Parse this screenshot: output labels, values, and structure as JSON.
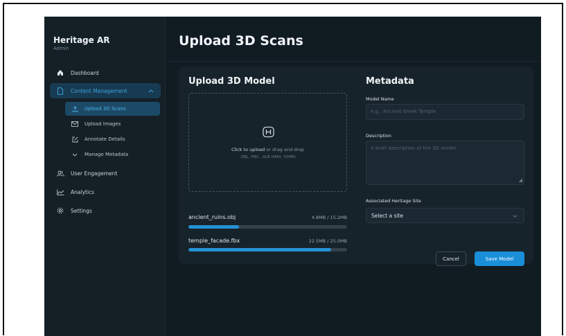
{
  "sidebar": {
    "app_title": "Heritage AR",
    "role": "Admin",
    "items": [
      {
        "label": "Dashboard",
        "icon": "home-icon"
      },
      {
        "label": "Content Management",
        "icon": "document-icon"
      },
      {
        "label": "User Engagement",
        "icon": "users-icon"
      },
      {
        "label": "Analytics",
        "icon": "chart-icon"
      },
      {
        "label": "Settings",
        "icon": "gear-icon"
      }
    ],
    "subitems": [
      {
        "label": "Upload 3D Scans",
        "icon": "upload-icon"
      },
      {
        "label": "Upload Images",
        "icon": "image-icon"
      },
      {
        "label": "Annotate Details",
        "icon": "edit-icon"
      },
      {
        "label": "Manage Metadata",
        "icon": "chevron-down-icon"
      }
    ]
  },
  "main": {
    "page_title": "Upload 3D Scans",
    "upload": {
      "title": "Upload 3D Model",
      "dropzone_action": "Click to upload",
      "dropzone_rest": " or drag and drop",
      "dropzone_formats": ".OBJ, .FBX, .GLB (MAX. 50MB)",
      "files": [
        {
          "name": "ancient_ruins.obj",
          "size": "4.8MB / 15.2MB",
          "progress": 0.32
        },
        {
          "name": "temple_facade.fbx",
          "size": "22.5MB / 25.0MB",
          "progress": 0.9
        }
      ]
    },
    "metadata": {
      "title": "Metadata",
      "model_name_label": "Model Name",
      "model_name_placeholder": "e.g., Ancient Greek Temple",
      "description_label": "Description",
      "description_placeholder": "A brief description of the 3D model.",
      "site_label": "Associated Heritage Site",
      "site_value": "Select a site",
      "cancel_label": "Cancel",
      "save_label": "Save Model"
    }
  },
  "colors": {
    "background": "#111b22",
    "accent": "#1a8fd8",
    "active_nav": "#173b52"
  }
}
